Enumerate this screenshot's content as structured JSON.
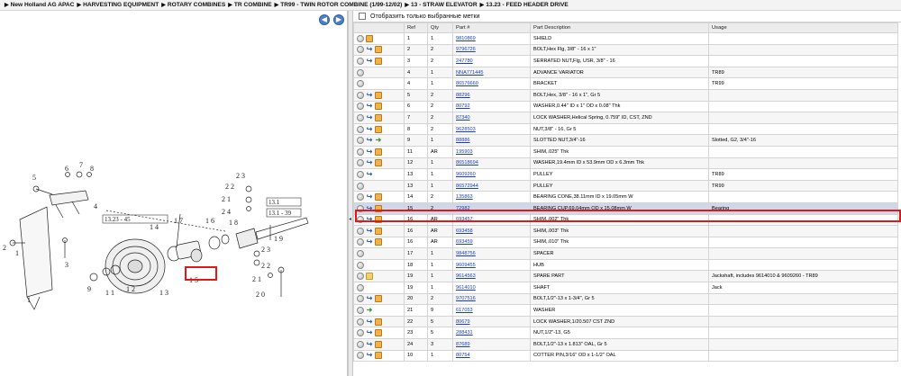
{
  "breadcrumb": [
    "New Holland AG APAC",
    "HARVESTING EQUIPMENT",
    "ROTARY COMBINES",
    "TR COMBINE",
    "TR99 - TWIN ROTOR COMBINE (1/99-12/02)",
    "13 - STRAW ELEVATOR",
    "13.23 - FEED HEADER DRIVE"
  ],
  "filter": {
    "label": "Отобразить только выбранные метки"
  },
  "nav": {
    "back": "◀",
    "forward": "▶"
  },
  "columns": {
    "ref": "Ref",
    "qty": "Qty",
    "part": "Part #",
    "desc": "Part Description",
    "usage": "Usage"
  },
  "diagram": {
    "refs": [
      "1",
      "2",
      "3",
      "4",
      "5",
      "6",
      "7",
      "8",
      "9",
      "10",
      "11",
      "12",
      "13",
      "14",
      "15",
      "16",
      "17",
      "18",
      "19",
      "20",
      "21",
      "22",
      "23",
      "24"
    ],
    "section_labels": [
      "13.23 - 45",
      "13.1",
      "13.1 - 39"
    ]
  },
  "rows": [
    {
      "icons": [
        "cart",
        "box"
      ],
      "ref": "1",
      "qty": "1",
      "part": "9810869",
      "desc": "SHIELD",
      "usage": ""
    },
    {
      "icons": [
        "cart",
        "link",
        "box"
      ],
      "ref": "2",
      "qty": "2",
      "part": "9796726",
      "desc": "BOLT,Hex Flg, 3/8\" - 16 x 1\"",
      "usage": ""
    },
    {
      "icons": [
        "cart",
        "link",
        "box"
      ],
      "ref": "3",
      "qty": "2",
      "part": "247780",
      "desc": "SERRATED NUT,Flg, USR, 3/8\" - 16",
      "usage": ""
    },
    {
      "icons": [
        "cart"
      ],
      "ref": "4",
      "qty": "1",
      "part": "NNA771445",
      "desc": "ADVANCE VARIATOR",
      "usage": "TR89"
    },
    {
      "icons": [
        "cart"
      ],
      "ref": "4",
      "qty": "1",
      "part": "86576660",
      "desc": "BRACKET",
      "usage": "TR99"
    },
    {
      "icons": [
        "cart",
        "link",
        "box"
      ],
      "ref": "5",
      "qty": "2",
      "part": "88296",
      "desc": "BOLT,Hex, 3/8\" - 16  x 1\", Gr 5",
      "usage": ""
    },
    {
      "icons": [
        "cart",
        "link",
        "box"
      ],
      "ref": "6",
      "qty": "2",
      "part": "80792",
      "desc": "WASHER,0.44\" ID x 1\" OD x 0.08\" Thk",
      "usage": ""
    },
    {
      "icons": [
        "cart",
        "link",
        "box"
      ],
      "ref": "7",
      "qty": "2",
      "part": "87340",
      "desc": "LOCK WASHER,Helical Spring, 0.759\" ID, CST, ZND",
      "usage": ""
    },
    {
      "icons": [
        "cart",
        "link",
        "box"
      ],
      "ref": "8",
      "qty": "2",
      "part": "9628503",
      "desc": "NUT,3/8\" - 16, Gr 5",
      "usage": ""
    },
    {
      "icons": [
        "cart",
        "link",
        "go"
      ],
      "ref": "9",
      "qty": "1",
      "part": "88886",
      "desc": "SLOTTED NUT,3/4\"-16",
      "usage": "Slotted, G2,  3/4\"-16"
    },
    {
      "icons": [
        "cart",
        "link",
        "box"
      ],
      "ref": "11",
      "qty": "AR",
      "part": "195903",
      "desc": "SHIM,.025\" Thk",
      "usage": ""
    },
    {
      "icons": [
        "cart",
        "link",
        "box"
      ],
      "ref": "12",
      "qty": "1",
      "part": "86518694",
      "desc": "WASHER,19.4mm ID x 53.9mm OD x 6.3mm Thk",
      "usage": ""
    },
    {
      "icons": [
        "cart",
        "link"
      ],
      "ref": "13",
      "qty": "1",
      "part": "9609260",
      "desc": "PULLEY",
      "usage": "TR89"
    },
    {
      "icons": [
        "cart"
      ],
      "ref": "13",
      "qty": "1",
      "part": "86572944",
      "desc": "PULLEY",
      "usage": "TR99"
    },
    {
      "icons": [
        "cart",
        "link",
        "box"
      ],
      "ref": "14",
      "qty": "2",
      "part": "135863",
      "desc": "BEARING CONE,38.11mm ID x 19.05mm W",
      "usage": ""
    },
    {
      "icons": [
        "cart",
        "link",
        "box"
      ],
      "ref": "15",
      "qty": "2",
      "part": "72982",
      "desc": "BEARING CUP,69.04mm OD x 15.08mm W",
      "usage": "Bearing",
      "highlight": true
    },
    {
      "icons": [
        "cart",
        "link",
        "box"
      ],
      "ref": "16",
      "qty": "AR",
      "part": "693457",
      "desc": "SHIM,.002\" Thk",
      "usage": ""
    },
    {
      "icons": [
        "cart",
        "link",
        "box"
      ],
      "ref": "16",
      "qty": "AR",
      "part": "693458",
      "desc": "SHIM,.003\" Thk",
      "usage": ""
    },
    {
      "icons": [
        "cart",
        "link",
        "box"
      ],
      "ref": "16",
      "qty": "AR",
      "part": "693459",
      "desc": "SHIM,.010\" Thk",
      "usage": ""
    },
    {
      "icons": [
        "cart"
      ],
      "ref": "17",
      "qty": "1",
      "part": "9848756",
      "desc": "SPACER",
      "usage": ""
    },
    {
      "icons": [
        "cart"
      ],
      "ref": "18",
      "qty": "1",
      "part": "9609455",
      "desc": "HUB",
      "usage": ""
    },
    {
      "icons": [
        "cart",
        "fold"
      ],
      "ref": "19",
      "qty": "1",
      "part": "9614563",
      "desc": "SPARE PART",
      "usage": "Jackshaft, includes 9614010 & 9609260 - TR89"
    },
    {
      "icons": [
        "cart"
      ],
      "ref": "19",
      "qty": "1",
      "part": "9614010",
      "desc": "SHAFT",
      "usage": "Jack"
    },
    {
      "icons": [
        "cart",
        "link",
        "box"
      ],
      "ref": "20",
      "qty": "2",
      "part": "9707516",
      "desc": "BOLT,1/2\"-13 x 1-3/4\", Gr 5",
      "usage": ""
    },
    {
      "icons": [
        "cart",
        "go"
      ],
      "ref": "21",
      "qty": "9",
      "part": "617053",
      "desc": "WASHER",
      "usage": ""
    },
    {
      "icons": [
        "cart",
        "link",
        "box"
      ],
      "ref": "22",
      "qty": "5",
      "part": "80679",
      "desc": "LOCK WASHER,1/20.507 CST ZND",
      "usage": ""
    },
    {
      "icons": [
        "cart",
        "link",
        "box"
      ],
      "ref": "23",
      "qty": "5",
      "part": "288431",
      "desc": "NUT,1/2\"-13, G5",
      "usage": ""
    },
    {
      "icons": [
        "cart",
        "link",
        "box"
      ],
      "ref": "24",
      "qty": "3",
      "part": "87689",
      "desc": "BOLT,1/2\"-13 x 1.813\" OAL, Gr 5",
      "usage": ""
    },
    {
      "icons": [
        "cart",
        "link",
        "box"
      ],
      "ref": "10",
      "qty": "1",
      "part": "80754",
      "desc": "COTTER PIN,3/16\" OD x 1-1/2\" OAL",
      "usage": ""
    }
  ]
}
